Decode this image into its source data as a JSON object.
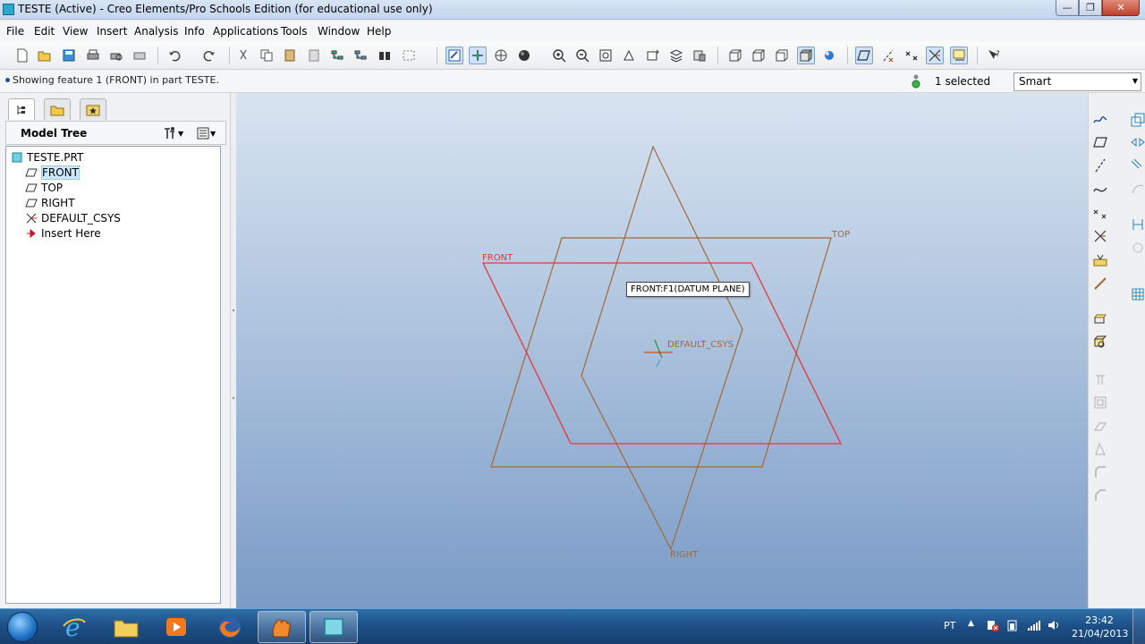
{
  "window": {
    "title": "TESTE (Active) - Creo Elements/Pro Schools Edition (for educational use only)",
    "controls": [
      "minimize",
      "maximize",
      "close"
    ]
  },
  "menubar": {
    "items": [
      {
        "label": "File"
      },
      {
        "label": "Edit"
      },
      {
        "label": "View"
      },
      {
        "label": "Insert"
      },
      {
        "label": "Analysis"
      },
      {
        "label": "Info"
      },
      {
        "label": "Applications"
      },
      {
        "label": "Tools"
      },
      {
        "label": "Window"
      },
      {
        "label": "Help"
      }
    ]
  },
  "toolbar": {
    "icons": [
      "new-file-icon",
      "open-folder-icon",
      "save-icon",
      "print-icon",
      "print-preview-icon",
      "send-icon",
      "undo-icon",
      "redo-icon",
      "cut-icon",
      "copy-icon",
      "paste-icon",
      "paste-special-icon",
      "regenerate-icon",
      "regenerate-manager-icon",
      "find-icon",
      "select-box-icon",
      "repaint-icon",
      "spin-center-icon",
      "orient-mode-icon",
      "display-style-icon",
      "zoom-in-icon",
      "zoom-out-icon",
      "refit-icon",
      "reorient-icon",
      "saved-views-icon",
      "layers-icon",
      "appearance-icon",
      "wireframe-icon",
      "hidden-line-icon",
      "no-hidden-icon",
      "shading-icon",
      "enhanced-realism-icon",
      "datum-planes-display-icon",
      "datum-axes-display-icon",
      "datum-points-display-icon",
      "csys-display-icon",
      "annotation-display-icon",
      "whats-this-icon"
    ]
  },
  "status": {
    "message": "Showing feature 1 (FRONT) in part TESTE.",
    "selection_count": "1 selected",
    "filter_value": "Smart"
  },
  "panel": {
    "tabs": [
      "model-tree-tab",
      "folder-browser-tab",
      "favorites-tab"
    ],
    "title": "Model Tree"
  },
  "tree": {
    "nodes": [
      {
        "label": "TESTE.PRT",
        "icon": "part-icon",
        "depth": 0
      },
      {
        "label": "FRONT",
        "icon": "datum-plane-icon",
        "depth": 1,
        "selected": true
      },
      {
        "label": "TOP",
        "icon": "datum-plane-icon",
        "depth": 1
      },
      {
        "label": "RIGHT",
        "icon": "datum-plane-icon",
        "depth": 1
      },
      {
        "label": "DEFAULT_CSYS",
        "icon": "csys-icon",
        "depth": 1
      },
      {
        "label": "Insert Here",
        "icon": "insert-arrow-icon",
        "depth": 1
      }
    ]
  },
  "graphics": {
    "plane_labels": {
      "front": "FRONT",
      "top": "TOP",
      "right": "RIGHT"
    },
    "csys_label": "DEFAULT_CSYS",
    "tooltip": "FRONT:F1(DATUM PLANE)",
    "colors": {
      "front_plane": "#e8373a",
      "other_planes": "#a0693a",
      "csys": "#c8502a"
    }
  },
  "taskbar": {
    "apps": [
      "internet-explorer-icon",
      "file-explorer-icon",
      "media-player-icon",
      "firefox-icon",
      "creo-launcher-icon",
      "creo-window-icon"
    ],
    "language": "PT",
    "time": "23:42",
    "date": "21/04/2013"
  }
}
